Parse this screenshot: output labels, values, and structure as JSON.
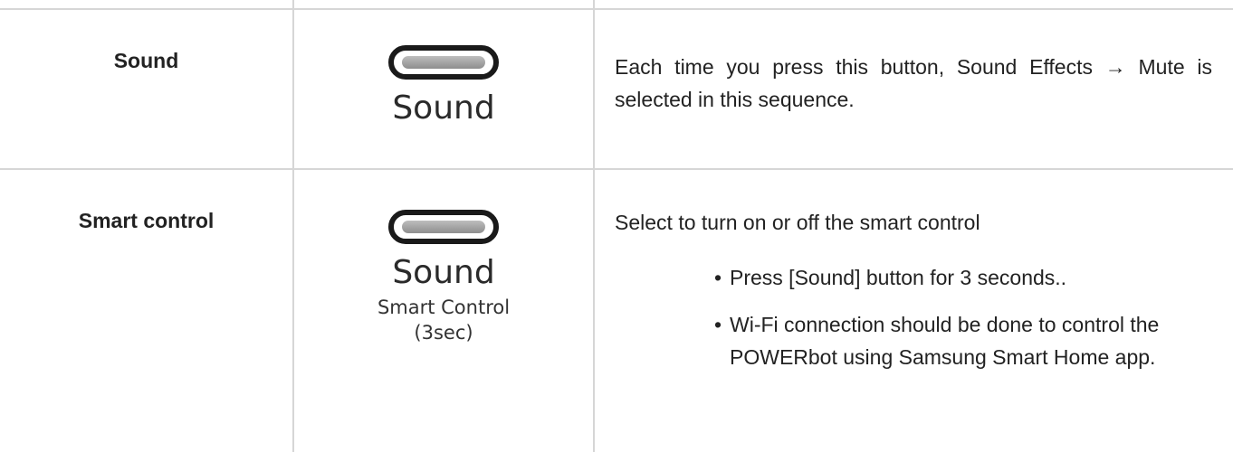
{
  "rows": [
    {
      "name": "Sound",
      "button": {
        "label": "Sound",
        "sub": [],
        "icon": "pill-button-icon"
      },
      "description": "Each time you press this button, Sound Effects → Mute is selected in this sequence.",
      "bullets": []
    },
    {
      "name": "Smart control",
      "button": {
        "label": "Sound",
        "sub": [
          "Smart Control",
          "(3sec)"
        ],
        "icon": "pill-button-icon"
      },
      "description": "Select to turn on or off the smart control",
      "bullets": [
        "Press [Sound] button for 3 seconds..",
        "Wi-Fi connection should be done to control the POWERbot using Samsung Smart Home app."
      ]
    }
  ],
  "colors": {
    "border": "#d6d6d6",
    "text": "#222222",
    "pill_border": "#1a1a1a",
    "pill_fill": "#a0a0a0"
  }
}
